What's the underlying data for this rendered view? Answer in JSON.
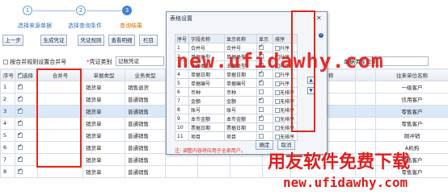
{
  "steps": [
    {
      "num": "1",
      "label": "选择来源单据"
    },
    {
      "num": "2",
      "label": "选择查询条件"
    },
    {
      "num": "3",
      "label": "查询结果"
    }
  ],
  "toolbar": [
    "上一步",
    "生成凭证",
    "凭证规则",
    "查看明细",
    "栏目"
  ],
  "options": {
    "merge_label": "按合并规则设置合并号",
    "voucher_type_label": "凭证类别",
    "voucher_type_value": "记账凭证"
  },
  "right_filter": {
    "label": "单据类型",
    "value": "全部"
  },
  "grid": {
    "headers": [
      "序号",
      "选择",
      "合并号",
      "单据类型",
      "业务类型",
      "",
      "",
      "",
      "",
      "人员名称",
      "",
      "往来单位名称"
    ],
    "rows": [
      {
        "no": "1",
        "checked": true,
        "type": "销货单",
        "biz": "销售退货",
        "partner": "一级客户"
      },
      {
        "no": "2",
        "checked": true,
        "type": "销货单",
        "biz": "普通销售",
        "partner": "信用客户"
      },
      {
        "no": "3",
        "checked": true,
        "type": "销货单",
        "biz": "普通销售",
        "partner": "零售客户"
      },
      {
        "no": "4",
        "checked": true,
        "type": "销货单",
        "biz": "普通销售",
        "partner": "零售客户"
      },
      {
        "no": "5",
        "checked": true,
        "type": "销货单",
        "biz": "普通销售",
        "partner": "刚冲销"
      },
      {
        "no": "6",
        "checked": true,
        "type": "销货单",
        "biz": "普通销售",
        "partner": "A机构"
      },
      {
        "no": "7",
        "checked": true,
        "type": "销货单",
        "biz": "普通销售",
        "partner": "零售客户"
      },
      {
        "no": "8",
        "checked": true,
        "type": "销货单",
        "biz": "普通销售",
        "partner": "零售客户"
      }
    ]
  },
  "dialog": {
    "title": "表格设置",
    "headers": [
      "序号",
      "字段名称",
      "显示名称",
      "显示",
      "排序"
    ],
    "rows": [
      {
        "no": "1",
        "field": "合并号",
        "disp": "合并号",
        "show": true,
        "sort": "升序"
      },
      {
        "no": "2",
        "field": "单据类型",
        "disp": "单据类型",
        "show": true,
        "sort": "升序"
      },
      {
        "no": "3",
        "field": "业务类型",
        "disp": "业务类型",
        "show": true,
        "sort": "升序"
      },
      {
        "no": "4",
        "field": "单据日期",
        "disp": "单据日期",
        "show": true,
        "sort": "升序"
      },
      {
        "no": "5",
        "field": "单据编号",
        "disp": "单据编号",
        "show": true,
        "sort": "升序"
      },
      {
        "no": "6",
        "field": "币种",
        "disp": "币种",
        "show": false,
        "sort": "无排序"
      },
      {
        "no": "7",
        "field": "金额",
        "disp": "金额",
        "show": true,
        "sort": "无排序"
      },
      {
        "no": "8",
        "field": "账号",
        "disp": "账号",
        "show": false,
        "sort": "无排序"
      },
      {
        "no": "9",
        "field": "本币金额",
        "disp": "本币金额",
        "show": true,
        "sort": "无排序"
      },
      {
        "no": "10",
        "field": "票据日期",
        "disp": "票据日期",
        "show": false,
        "sort": "无排序"
      },
      {
        "no": "11",
        "field": "项目",
        "disp": "项目",
        "show": false,
        "sort": "无排序"
      }
    ],
    "note": "注: 调整内容将应用于全部用户。",
    "ok": "确定",
    "cancel": "取消"
  },
  "watermark": {
    "url_big": "new.ufidawhy.com",
    "slogan": "用友软件免费下载",
    "url_small": "new.ufidawhy.com"
  },
  "colors": {
    "accent": "#3f83d8",
    "highlight": "#e0281e",
    "watermark": "#e01e1e"
  }
}
